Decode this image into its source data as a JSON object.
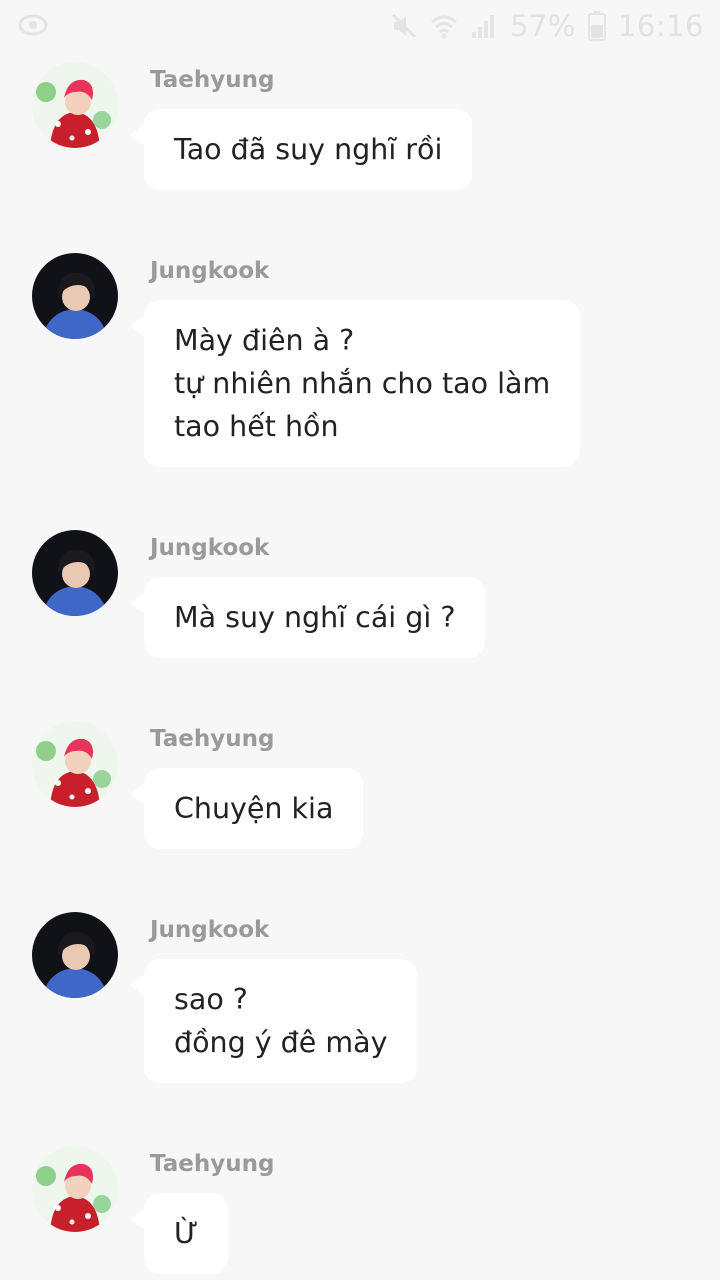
{
  "status_bar": {
    "battery_percent": "57%",
    "time": "16:16",
    "left_icon": "eye-icon",
    "icons": [
      "mute-icon",
      "wifi-icon",
      "signal-icon",
      "battery-icon"
    ]
  },
  "messages": [
    {
      "sender": "Taehyung",
      "avatar": "taehyung-avatar",
      "text": "Tao đã suy nghĩ rồi"
    },
    {
      "sender": "Jungkook",
      "avatar": "jungkook-avatar",
      "text": "Mày điên à ?\ntự nhiên nhắn cho tao làm\ntao hết hồn"
    },
    {
      "sender": "Jungkook",
      "avatar": "jungkook-avatar",
      "text": "Mà suy nghĩ cái gì ?"
    },
    {
      "sender": "Taehyung",
      "avatar": "taehyung-avatar",
      "text": "Chuyện kia"
    },
    {
      "sender": "Jungkook",
      "avatar": "jungkook-avatar",
      "text": "sao ?\nđồng ý đê mày"
    },
    {
      "sender": "Taehyung",
      "avatar": "taehyung-avatar",
      "text": "Ừ"
    }
  ],
  "colors": {
    "background": "#f7f7f7",
    "bubble": "#ffffff",
    "sender_name": "#9a9a9a",
    "message_text": "#222222",
    "status_icons": "#e4e4e4"
  }
}
